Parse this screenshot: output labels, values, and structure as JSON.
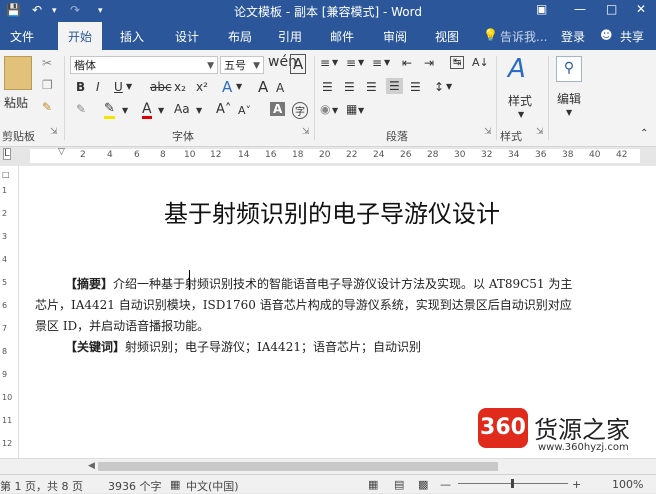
{
  "window": {
    "title": "论文模板 - 副本 [兼容模式] - Word"
  },
  "tabs": [
    "文件",
    "开始",
    "插入",
    "设计",
    "布局",
    "引用",
    "邮件",
    "审阅",
    "视图"
  ],
  "active_tab": "开始",
  "tell_me": "告诉我...",
  "login": "登录",
  "share": "共享",
  "ribbon": {
    "clipboard": {
      "paste": "粘贴",
      "group": "剪贴板"
    },
    "font": {
      "name": "楷体",
      "size": "五号",
      "group": "字体",
      "wen": "wén",
      "grow": "A",
      "shrink": "A",
      "aa": "Aa",
      "clear": "A",
      "bold": "B",
      "italic": "I",
      "underline": "U",
      "strike": "abc",
      "sub": "x₂",
      "sup": "x²"
    },
    "paragraph": {
      "group": "段落"
    },
    "styles": {
      "label": "样式",
      "group": "样式"
    },
    "editing": {
      "label": "编辑"
    }
  },
  "ruler": [
    "2",
    "4",
    "6",
    "8",
    "10",
    "12",
    "14",
    "16",
    "18",
    "20",
    "22",
    "24",
    "26",
    "28",
    "30",
    "32",
    "34",
    "36",
    "38",
    "40",
    "42"
  ],
  "vruler": [
    "1",
    "2",
    "3",
    "4",
    "5",
    "6",
    "7",
    "8",
    "9",
    "10",
    "11",
    "12"
  ],
  "document": {
    "title": "基于射频识别的电子导游仪设计",
    "abstract_label": "【摘要】",
    "abstract_line1": "介绍一种基于射频识别技术的智能语音电子导游仪设计方法及实现。以 AT89C51 为主",
    "abstract_line2": "芯片，IA4421 自动识别模块，ISD1760 语音芯片构成的导游仪系统，实现到达景区后自动识别对应",
    "abstract_line3": "景区 ID，并启动语音播报功能。",
    "keywords_label": "【关键词】",
    "keywords": "射频识别；电子导游仪；IA4421；语音芯片；自动识别"
  },
  "status": {
    "page": "第 1 页，共 8 页",
    "words": "3936 个字",
    "lang": "中文(中国)",
    "zoom": "100%"
  },
  "watermark": {
    "logo": "360",
    "name": "货源之家",
    "url": "www.360hyzj.com"
  }
}
